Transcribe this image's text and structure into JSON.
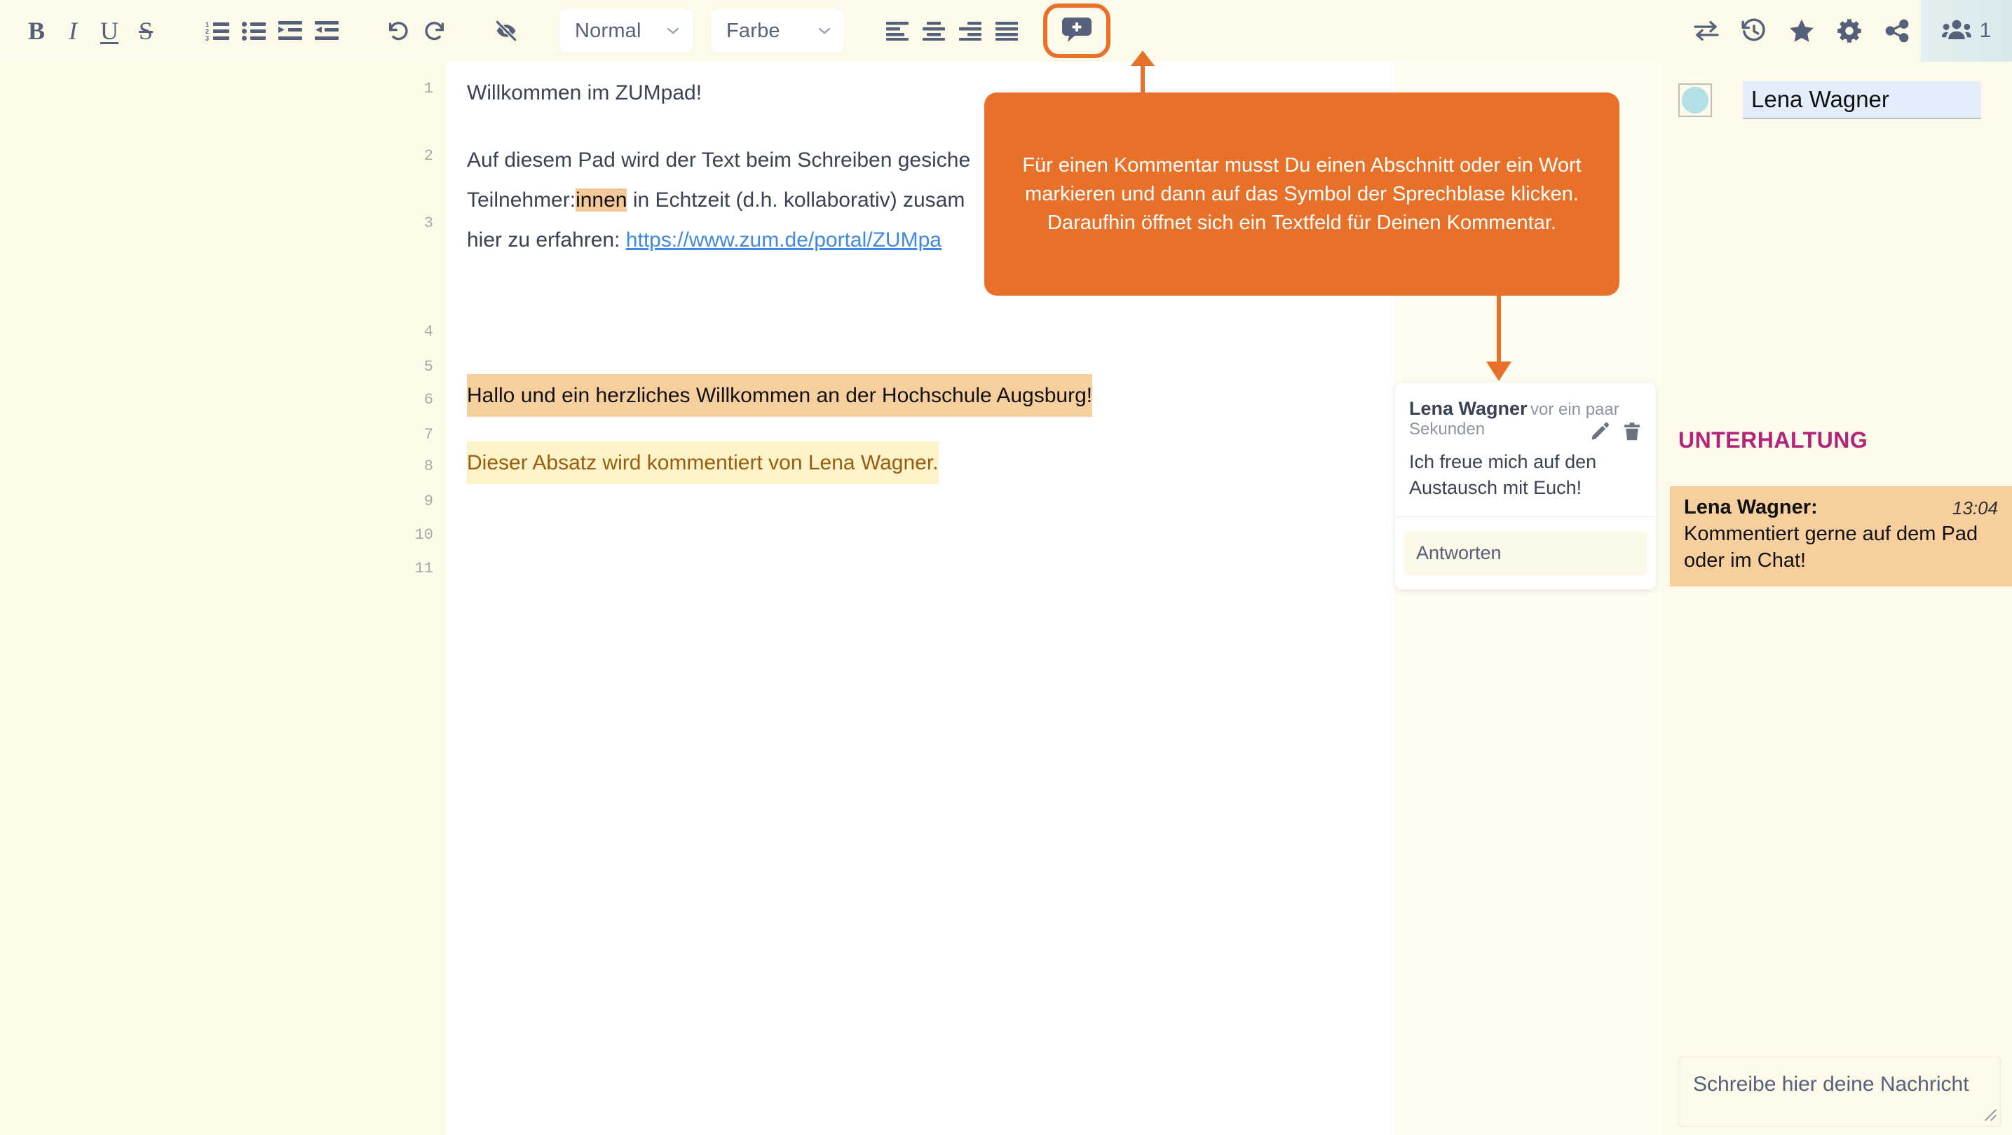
{
  "toolbar": {
    "bold": "B",
    "italic": "I",
    "underline": "U",
    "strikethrough": "S",
    "ordered_list_icon": "ordered-list-icon",
    "unordered_list_icon": "unordered-list-icon",
    "indent_icon": "indent-icon",
    "outdent_icon": "outdent-icon",
    "undo_icon": "undo-icon",
    "redo_icon": "redo-icon",
    "clear_authorship_icon": "eye-slash-icon",
    "style_select": {
      "value": "Normal",
      "chevron": "⌄"
    },
    "color_select": {
      "value": "Farbe",
      "chevron": "⌄"
    },
    "align_left_icon": "align-left-icon",
    "align_center_icon": "align-center-icon",
    "align_right_icon": "align-right-icon",
    "align_justify_icon": "align-justify-icon",
    "comment_icon": "comment-add-icon",
    "import_export_icon": "import-export-icon",
    "history_icon": "history-icon",
    "star_icon": "star-icon",
    "settings_icon": "gear-icon",
    "share_icon": "share-icon",
    "users_icon": "users-icon",
    "users_count": "1",
    "highlight_color": "#e8712a",
    "icon_color": "#55617a"
  },
  "editor": {
    "line_numbers": [
      "1",
      "2",
      "3",
      "4",
      "5",
      "6",
      "7",
      "8",
      "9",
      "10",
      "11"
    ],
    "paragraphs": {
      "p1": "Willkommen im ZUMpad!",
      "p3_line1": "Auf diesem Pad wird der Text beim Schreiben gesiche",
      "p3_line2_a": "Teilnehmer:",
      "p3_line2_hl": "innen",
      "p3_line2_b": " in Echtzeit (d.h. kollaborativ) zusam",
      "p3_line3_a": "hier zu erfahren: ",
      "p3_line3_link": "https://www.zum.de/portal/ZUMpa",
      "p6": "Hallo und ein herzliches Willkommen an der Hochschule Augsburg!",
      "p8": "Dieser Absatz wird kommentiert von Lena Wagner."
    }
  },
  "comment": {
    "author": "Lena Wagner",
    "time": "vor ein paar Sekunden",
    "edit_icon": "pencil-icon",
    "delete_icon": "trash-icon",
    "body": "Ich freue mich auf den Austausch mit Euch!",
    "reply_label": "Antworten"
  },
  "tooltip": {
    "text": "Für einen Kommentar musst Du einen Abschnitt oder ein Wort markieren und dann auf das Symbol der Sprechblase klicken. Daraufhin öffnet sich ein Textfeld für Deinen Kommentar.",
    "color": "#e8712a"
  },
  "sidebar": {
    "username": "Lena Wagner",
    "avatar_color": "#b3dfe6",
    "chat_title": "UNTERHALTUNG",
    "chat_title_color": "#b3237a",
    "messages": [
      {
        "author": "Lena Wagner:",
        "time": "13:04",
        "text": "Kommentiert gerne auf dem Pad oder im Chat!"
      }
    ],
    "chat_input_placeholder": "Schreibe hier deine Nachricht",
    "resize_grip_icon": "resize-grip-icon"
  }
}
